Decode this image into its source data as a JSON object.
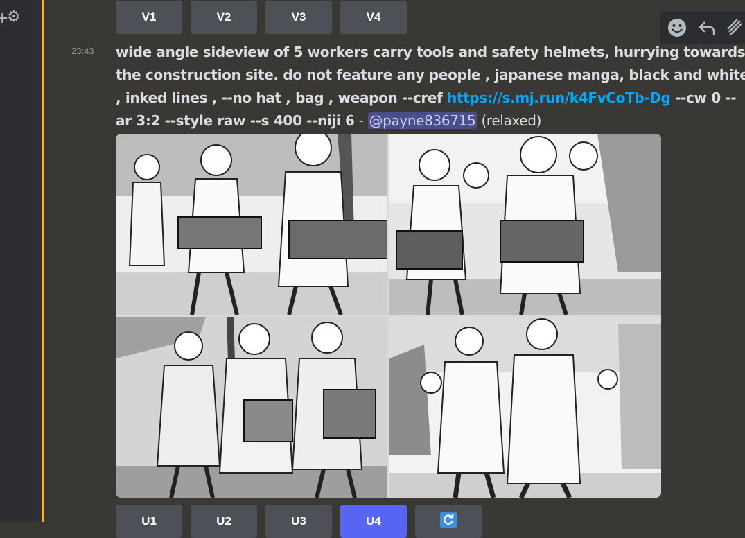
{
  "variation_buttons": [
    "V1",
    "V2",
    "V3",
    "V4"
  ],
  "upscale_buttons": [
    "U1",
    "U2",
    "U3",
    "U4"
  ],
  "reroll_icon": "refresh-icon",
  "toolbar_icons": [
    "emoji-icon",
    "reply-icon",
    "more-icon"
  ],
  "message": {
    "timestamp": "23:43",
    "prompt_text": "wide angle sideview of 5 workers carry tools and safety helmets, hurrying towards the construction site. do not feature any people , japanese manga, black and white , inked lines , --no hat , bag , weapon --cref ",
    "link_text": "https://s.mj.run/k4FvCoTb-Dg",
    "params_text": " --cw 0 --ar 3:2 --style raw --s 400 --niji 6",
    "separator": " - ",
    "mention": "@payne836715",
    "status": " (relaxed)"
  },
  "colors": {
    "mention_bar": "#f0b232",
    "link": "#00a8fc",
    "button": "#4e5058",
    "button_primary": "#5865f2",
    "background": "#3a3835"
  }
}
